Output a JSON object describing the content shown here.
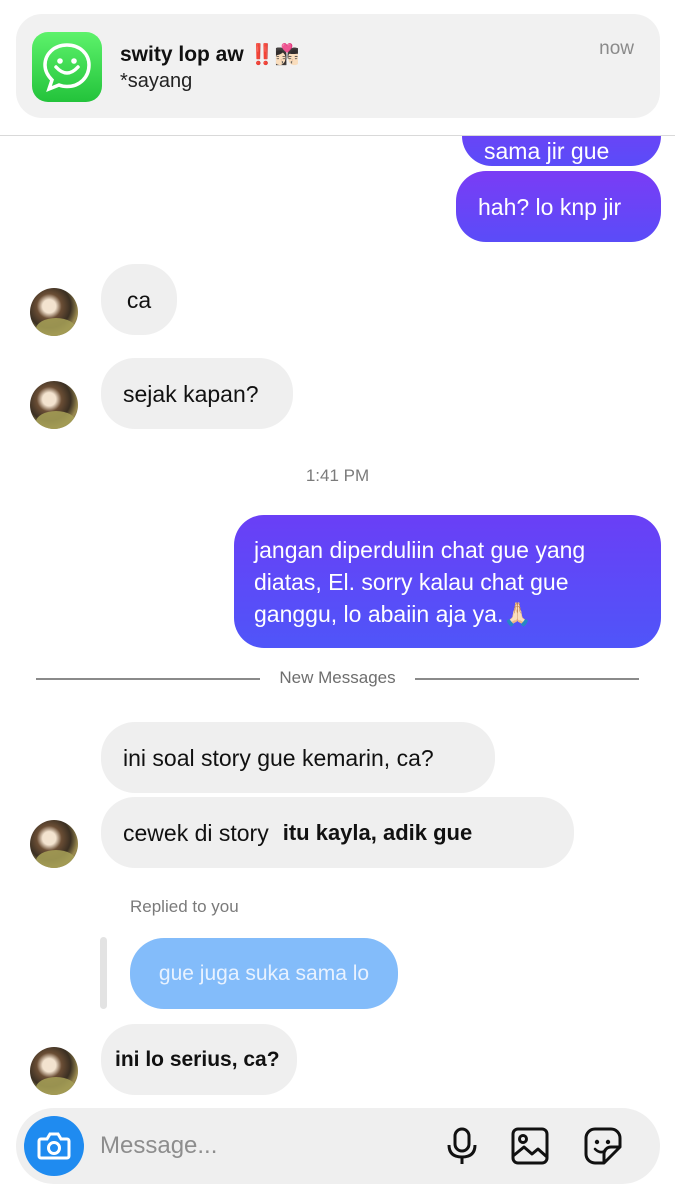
{
  "notification": {
    "app_icon": "whatsapp-smile-icon",
    "title": "swity lop aw",
    "title_emoji": "‼️👩🏻‍❤️‍💋‍👨🏻",
    "body": "*sayang",
    "time": "now"
  },
  "chat": {
    "partial_message": "sama jir gue",
    "outgoing_1": "hah? lo knp jir",
    "incoming_1": "ca",
    "incoming_2": "sejak kapan?",
    "timestamp": "1:41 PM",
    "outgoing_2": {
      "line1": "jangan diperduliin chat gue yang",
      "line2": "diatas, El. sorry kalau chat gue",
      "line3": "ganggu, lo abaiin aja ya.🙏🏻"
    },
    "new_messages_label": "New Messages",
    "incoming_3": "ini soal story gue kemarin, ca?",
    "incoming_4": "cewek di story",
    "incoming_4_overlay": "itu kayla, adik gue",
    "reply_label": "Replied to you",
    "replied_message": "gue juga suka sama lo",
    "incoming_5": "ini lo serius, ca?"
  },
  "composer": {
    "placeholder": "Message...",
    "icons": [
      "camera-icon",
      "microphone-icon",
      "image-icon",
      "sticker-icon"
    ]
  },
  "colors": {
    "outgoing_top": "#7a3cf5",
    "outgoing_bottom": "#5a4cf8",
    "incoming": "#efefef",
    "replied": "#83bcfa",
    "camera": "#1f8bf0"
  }
}
